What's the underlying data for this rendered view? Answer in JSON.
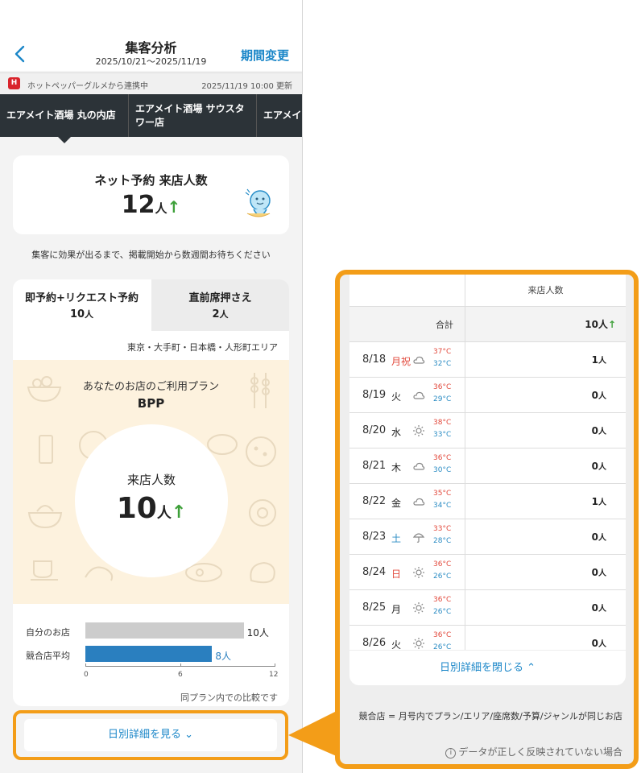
{
  "header": {
    "title": "集客分析",
    "period": "2025/10/21〜2025/11/19",
    "change_period": "期間変更"
  },
  "infobar": {
    "hp_icon": "H",
    "source": "ホットペッパーグルメから連携中",
    "updated": "2025/11/19 10:00 更新"
  },
  "store_tabs": [
    {
      "label": "エアメイト酒場 丸の内店"
    },
    {
      "label": "エアメイト酒場 サウスタワー店"
    },
    {
      "label": "エアメイ"
    }
  ],
  "net": {
    "title": "ネット予約 来店人数",
    "value": "12",
    "unit": "人",
    "trend": "↑"
  },
  "notice": "集客に効果が出るまで、掲載開始から数週間お待ちください",
  "segments": [
    {
      "label": "即予約+リクエスト予約",
      "value": "10",
      "unit": "人"
    },
    {
      "label": "直前席押さえ",
      "value": "2",
      "unit": "人"
    }
  ],
  "area": "東京・大手町・日本橋・人形町エリア",
  "plan": {
    "label": "あなたのお店のご利用プラン",
    "name": "BPP",
    "visitors_label": "来店人数",
    "visitors_value": "10",
    "visitors_unit": "人",
    "trend": "↑"
  },
  "chart_data": {
    "type": "bar",
    "orientation": "horizontal",
    "categories": [
      "自分のお店",
      "競合店平均"
    ],
    "values": [
      10,
      8
    ],
    "value_labels": [
      "10人",
      "8人"
    ],
    "colors": [
      "#cccccc",
      "#2a7fbf"
    ],
    "xlim": [
      0,
      12
    ],
    "xticks": [
      "0",
      "6",
      "12"
    ],
    "note": "同プラン内での比較です"
  },
  "button": {
    "label": "日別詳細を見る",
    "chevron": "⌄"
  },
  "daily": {
    "header": "来店人数",
    "total_label": "合計",
    "total_value": "10人",
    "total_trend": "↑",
    "rows": [
      {
        "date": "8/18",
        "dow": "月祝",
        "dow_color": "red",
        "weather": "cloud",
        "hi": "37°C",
        "lo": "32°C",
        "count": "1",
        "unit": "人"
      },
      {
        "date": "8/19",
        "dow": "火",
        "dow_color": "black",
        "weather": "cloud",
        "hi": "36°C",
        "lo": "29°C",
        "count": "0",
        "unit": "人"
      },
      {
        "date": "8/20",
        "dow": "水",
        "dow_color": "black",
        "weather": "sun",
        "hi": "38°C",
        "lo": "33°C",
        "count": "0",
        "unit": "人"
      },
      {
        "date": "8/21",
        "dow": "木",
        "dow_color": "black",
        "weather": "cloud",
        "hi": "36°C",
        "lo": "30°C",
        "count": "0",
        "unit": "人"
      },
      {
        "date": "8/22",
        "dow": "金",
        "dow_color": "black",
        "weather": "cloud",
        "hi": "35°C",
        "lo": "34°C",
        "count": "1",
        "unit": "人"
      },
      {
        "date": "8/23",
        "dow": "土",
        "dow_color": "blue",
        "weather": "umbrella",
        "hi": "33°C",
        "lo": "28°C",
        "count": "0",
        "unit": "人"
      },
      {
        "date": "8/24",
        "dow": "日",
        "dow_color": "red",
        "weather": "sun",
        "hi": "36°C",
        "lo": "26°C",
        "count": "0",
        "unit": "人"
      },
      {
        "date": "8/25",
        "dow": "月",
        "dow_color": "black",
        "weather": "sun",
        "hi": "36°C",
        "lo": "26°C",
        "count": "0",
        "unit": "人"
      },
      {
        "date": "8/26",
        "dow": "火",
        "dow_color": "black",
        "weather": "sun",
        "hi": "36°C",
        "lo": "26°C",
        "count": "0",
        "unit": "人"
      }
    ],
    "close_label": "日別詳細を閉じる",
    "close_chevron": "⌃",
    "competitor_note": "競合店 = 月号内でプラン/エリア/座席数/予算/ジャンルが同じお店",
    "info_link": "データが正しく反映されていない場合",
    "info_icon": "i"
  }
}
